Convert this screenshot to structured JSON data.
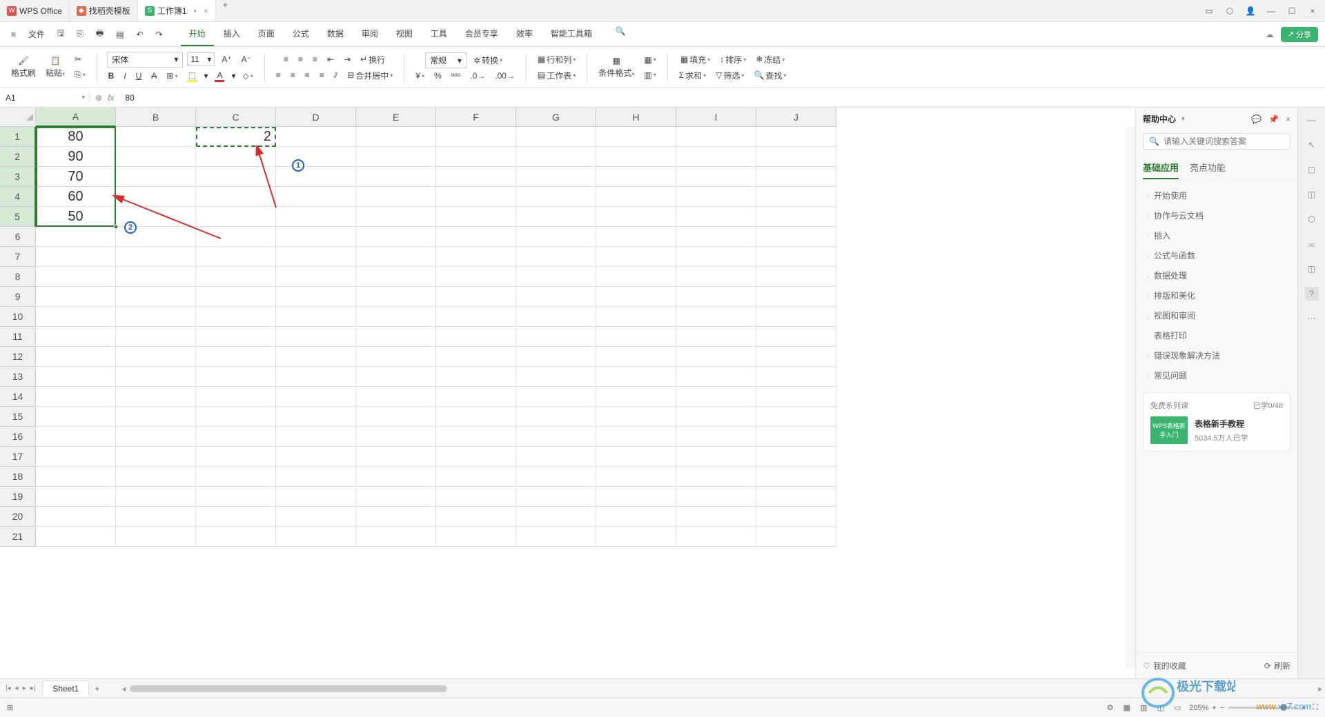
{
  "titleTabs": {
    "t0": "WPS Office",
    "t1": "找稻壳模板",
    "t2": "工作簿1"
  },
  "menu": {
    "file": "文件",
    "tabs": [
      "开始",
      "插入",
      "页面",
      "公式",
      "数据",
      "审阅",
      "视图",
      "工具",
      "会员专享",
      "效率",
      "智能工具箱"
    ]
  },
  "ribbon": {
    "formatBrush": "格式刷",
    "paste": "粘贴",
    "fontName": "宋体",
    "fontSize": "11",
    "wrap": "换行",
    "mergeCenter": "合并居中",
    "general": "常规",
    "convert": "转换",
    "rowCol": "行和列",
    "worksheet": "工作表",
    "condFormat": "条件格式",
    "fill": "填充",
    "sort": "排序",
    "freeze": "冻结",
    "sum": "求和",
    "filter": "筛选",
    "find": "查找"
  },
  "formulaBar": {
    "nameBox": "A1",
    "value": "80"
  },
  "columns": [
    "A",
    "B",
    "C",
    "D",
    "E",
    "F",
    "G",
    "H",
    "I",
    "J"
  ],
  "rows": [
    "1",
    "2",
    "3",
    "4",
    "5",
    "6",
    "7",
    "8",
    "9",
    "10",
    "11",
    "12",
    "13",
    "14",
    "15",
    "16",
    "17",
    "18",
    "19",
    "20",
    "21"
  ],
  "cells": {
    "A1": "80",
    "A2": "90",
    "A3": "70",
    "A4": "60",
    "A5": "50",
    "C1": "2"
  },
  "annotations": {
    "n1": "1",
    "n2": "2"
  },
  "helpPanel": {
    "title": "帮助中心",
    "searchPlaceholder": "请输入关键词搜索答案",
    "tabBasic": "基础应用",
    "tabHighlight": "亮点功能",
    "items": [
      "开始使用",
      "协作与云文档",
      "插入",
      "公式与函数",
      "数据处理",
      "排版和美化",
      "视图和审阅",
      "表格打印",
      "错误现象解决方法",
      "常见问题"
    ],
    "cardTag": "免费系列课",
    "cardProgress": "已学0/48",
    "thumbText": "WPS表格新手入门",
    "cardTitle": "表格新手教程",
    "cardSub": "5034.5万人已学",
    "fav": "我的收藏",
    "refresh": "刷新"
  },
  "sheetTab": "Sheet1",
  "status": {
    "zoom": "205%"
  },
  "share": "分享",
  "watermark": {
    "domain": "www.xz7.com",
    "name": "极光下载站"
  }
}
